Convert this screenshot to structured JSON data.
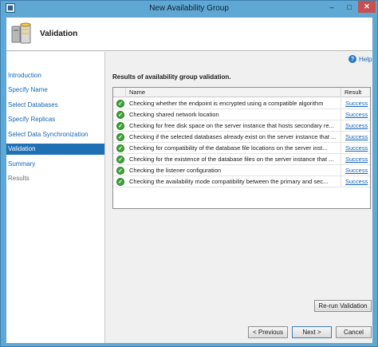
{
  "window": {
    "title": "New Availability Group"
  },
  "titlebar": {
    "minimize_glyph": "–",
    "maximize_glyph": "□",
    "close_glyph": "✕"
  },
  "header": {
    "title": "Validation",
    "icon": "database-wizard-icon"
  },
  "nav": {
    "items": [
      {
        "label": "Introduction",
        "state": "link"
      },
      {
        "label": "Specify Name",
        "state": "link"
      },
      {
        "label": "Select Databases",
        "state": "link"
      },
      {
        "label": "Specify Replicas",
        "state": "link"
      },
      {
        "label": "Select Data Synchronization",
        "state": "link"
      },
      {
        "label": "Validation",
        "state": "active"
      },
      {
        "label": "Summary",
        "state": "link"
      },
      {
        "label": "Results",
        "state": "disabled"
      }
    ]
  },
  "help": {
    "label": "Help",
    "glyph": "?"
  },
  "main": {
    "heading": "Results of availability group validation.",
    "columns": {
      "name": "Name",
      "result": "Result"
    },
    "rows": [
      {
        "name": "Checking whether the endpoint is encrypted using a compatible algorithm",
        "result": "Success"
      },
      {
        "name": "Checking shared network location",
        "result": "Success"
      },
      {
        "name": "Checking for free disk space on the server instance that hosts secondary re...",
        "result": "Success"
      },
      {
        "name": "Checking if the selected databases already exist on the server instance that ...",
        "result": "Success"
      },
      {
        "name": "Checking for compatibility of the database file locations on the server inst...",
        "result": "Success"
      },
      {
        "name": "Checking for the existence of the database files on the server instance that ...",
        "result": "Success"
      },
      {
        "name": "Checking the listener configuration",
        "result": "Success"
      },
      {
        "name": "Checking the availability mode compatibility between the primary and sec...",
        "result": "Success"
      }
    ],
    "status_glyph": "✓",
    "status_color": "#3ea339"
  },
  "buttons": {
    "rerun": "Re-run Validation",
    "previous": "< Previous",
    "next": "Next >",
    "cancel": "Cancel"
  },
  "colors": {
    "accent": "#1f6fb5",
    "link": "#1664b4",
    "frame": "#5fa8d3"
  }
}
